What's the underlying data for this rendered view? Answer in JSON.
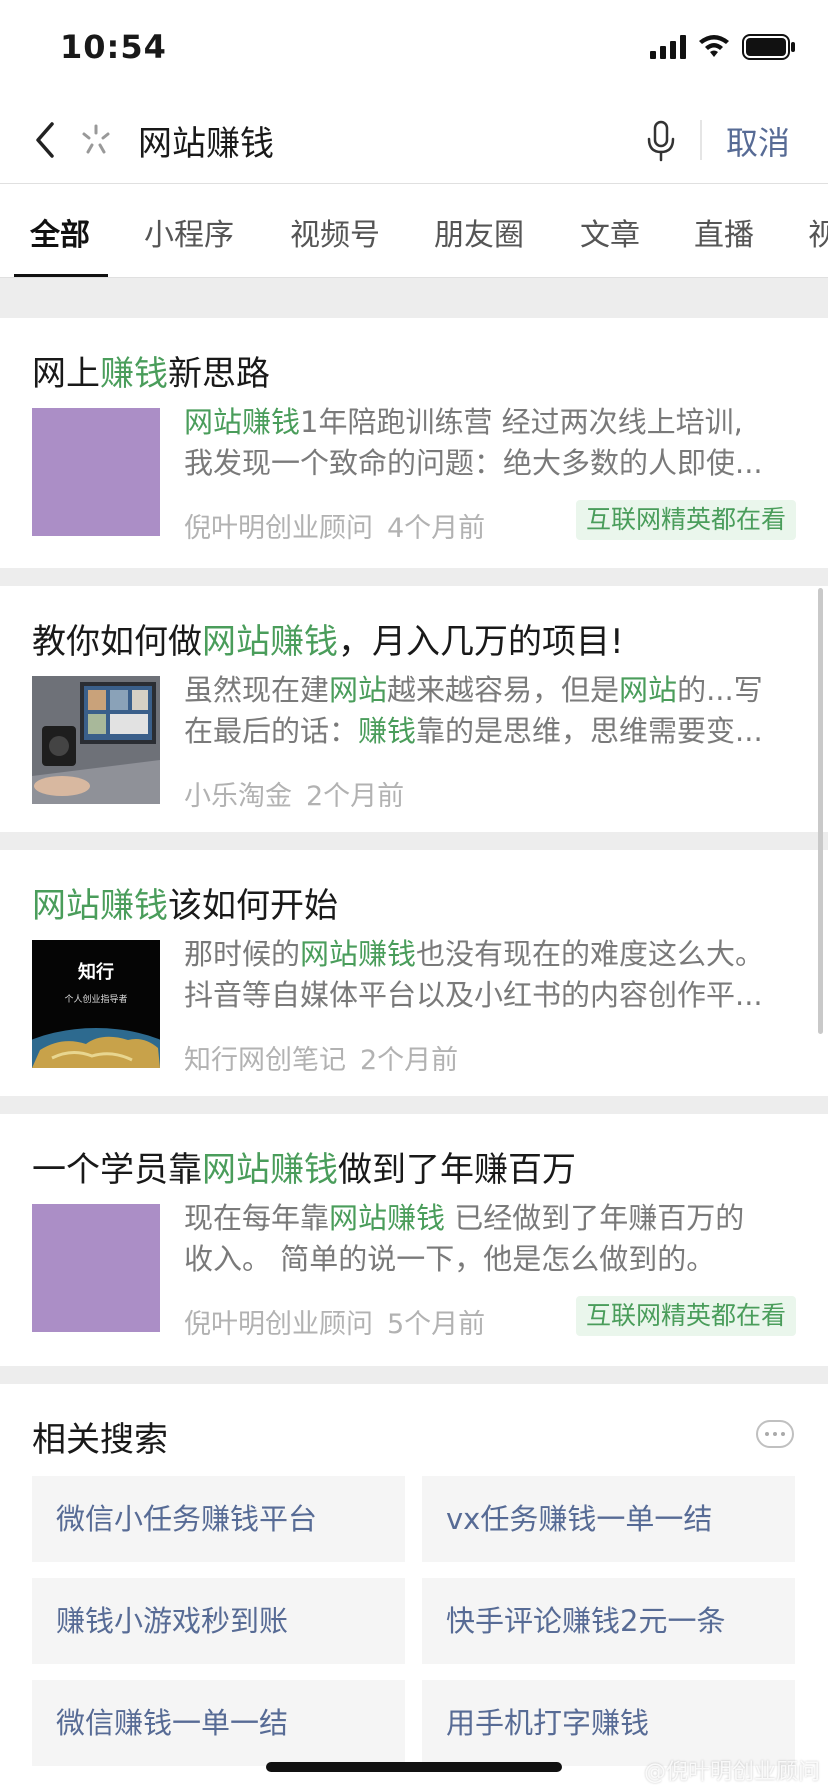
{
  "status": {
    "time": "10:54"
  },
  "search": {
    "query": "网站赚钱",
    "cancel_label": "取消"
  },
  "tabs": [
    "全部",
    "小程序",
    "视频号",
    "朋友圈",
    "文章",
    "直播",
    "视"
  ],
  "results": [
    {
      "title_parts": [
        {
          "t": "网上",
          "h": false
        },
        {
          "t": "赚钱",
          "h": true
        },
        {
          "t": "新思路",
          "h": false
        }
      ],
      "line1": [
        {
          "t": "网站赚钱",
          "h": true
        },
        {
          "t": "1年陪跑训练营 经过两次线上培训,",
          "h": false
        }
      ],
      "line2": [
        {
          "t": "我发现一个致命的问题：绝大多数的人即使...",
          "h": false
        }
      ],
      "author": "倪叶明创业顾问",
      "time": "4个月前",
      "badge": "互联网精英都在看"
    },
    {
      "title_parts": [
        {
          "t": "教你如何做",
          "h": false
        },
        {
          "t": "网站赚钱",
          "h": true
        },
        {
          "t": "，月入几万的项目!",
          "h": false
        }
      ],
      "line1": [
        {
          "t": "虽然现在建",
          "h": false
        },
        {
          "t": "网站",
          "h": true
        },
        {
          "t": "越来越容易，但是",
          "h": false
        },
        {
          "t": "网站",
          "h": true
        },
        {
          "t": "的...写",
          "h": false
        }
      ],
      "line2": [
        {
          "t": "在最后的话：",
          "h": false
        },
        {
          "t": "赚钱",
          "h": true
        },
        {
          "t": "靠的是思维，思维需要变...",
          "h": false
        }
      ],
      "author": "小乐淘金",
      "time": "2个月前",
      "badge": ""
    },
    {
      "title_parts": [
        {
          "t": "网站赚钱",
          "h": true
        },
        {
          "t": "该如何开始",
          "h": false
        }
      ],
      "line1": [
        {
          "t": "那时候的",
          "h": false
        },
        {
          "t": "网站赚钱",
          "h": true
        },
        {
          "t": "也没有现在的难度这么大。",
          "h": false
        }
      ],
      "line2": [
        {
          "t": "抖音等自媒体平台以及小红书的内容创作平...",
          "h": false
        }
      ],
      "author": "知行网创笔记",
      "time": "2个月前",
      "badge": "",
      "thumb_text": "知行",
      "thumb_sub": "个人创业指导者"
    },
    {
      "title_parts": [
        {
          "t": "一个学员靠",
          "h": false
        },
        {
          "t": "网站赚钱",
          "h": true
        },
        {
          "t": "做到了年赚百万",
          "h": false
        }
      ],
      "line1": [
        {
          "t": "现在每年靠",
          "h": false
        },
        {
          "t": "网站赚钱",
          "h": true
        },
        {
          "t": " 已经做到了年赚百万的",
          "h": false
        }
      ],
      "line2": [
        {
          "t": "收入。 简单的说一下，他是怎么做到的。",
          "h": false
        }
      ],
      "author": "倪叶明创业顾问",
      "time": "5个月前",
      "badge": "互联网精英都在看"
    }
  ],
  "related": {
    "title": "相关搜索",
    "items": [
      "微信小任务赚钱平台",
      "vx任务赚钱一单一结",
      "赚钱小游戏秒到账",
      "快手评论赚钱2元一条",
      "微信赚钱一单一结",
      "用手机打字赚钱"
    ]
  },
  "watermark": "@倪叶明创业顾问",
  "colors": {
    "highlight": "#4a9d5b",
    "link": "#576b95",
    "thumb_purple": "#ab8ec6",
    "badge_bg": "#eaf6ec"
  }
}
